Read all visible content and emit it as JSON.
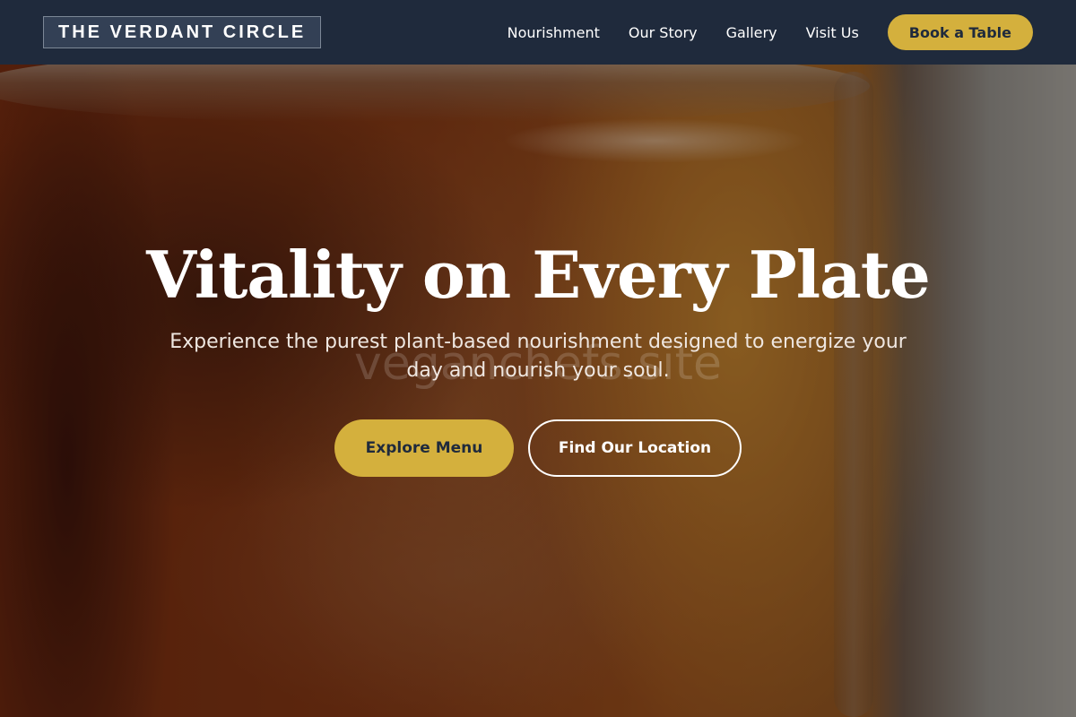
{
  "header": {
    "brand": "THE VERDANT CIRCLE",
    "nav": [
      {
        "label": "Nourishment"
      },
      {
        "label": "Our Story"
      },
      {
        "label": "Gallery"
      },
      {
        "label": "Visit Us"
      }
    ],
    "cta_label": "Book a Table"
  },
  "hero": {
    "title": "Vitality on Every Plate",
    "subtitle": "Experience the purest plant-based nourishment designed to energize your day and nourish your soul.",
    "watermark": "veganchefs.site",
    "primary_button": "Explore Menu",
    "secondary_button": "Find Our Location"
  },
  "theme": {
    "header_bg": "#1f2a3c",
    "accent_gold": "#d4b03d",
    "text_light": "#ffffff"
  }
}
